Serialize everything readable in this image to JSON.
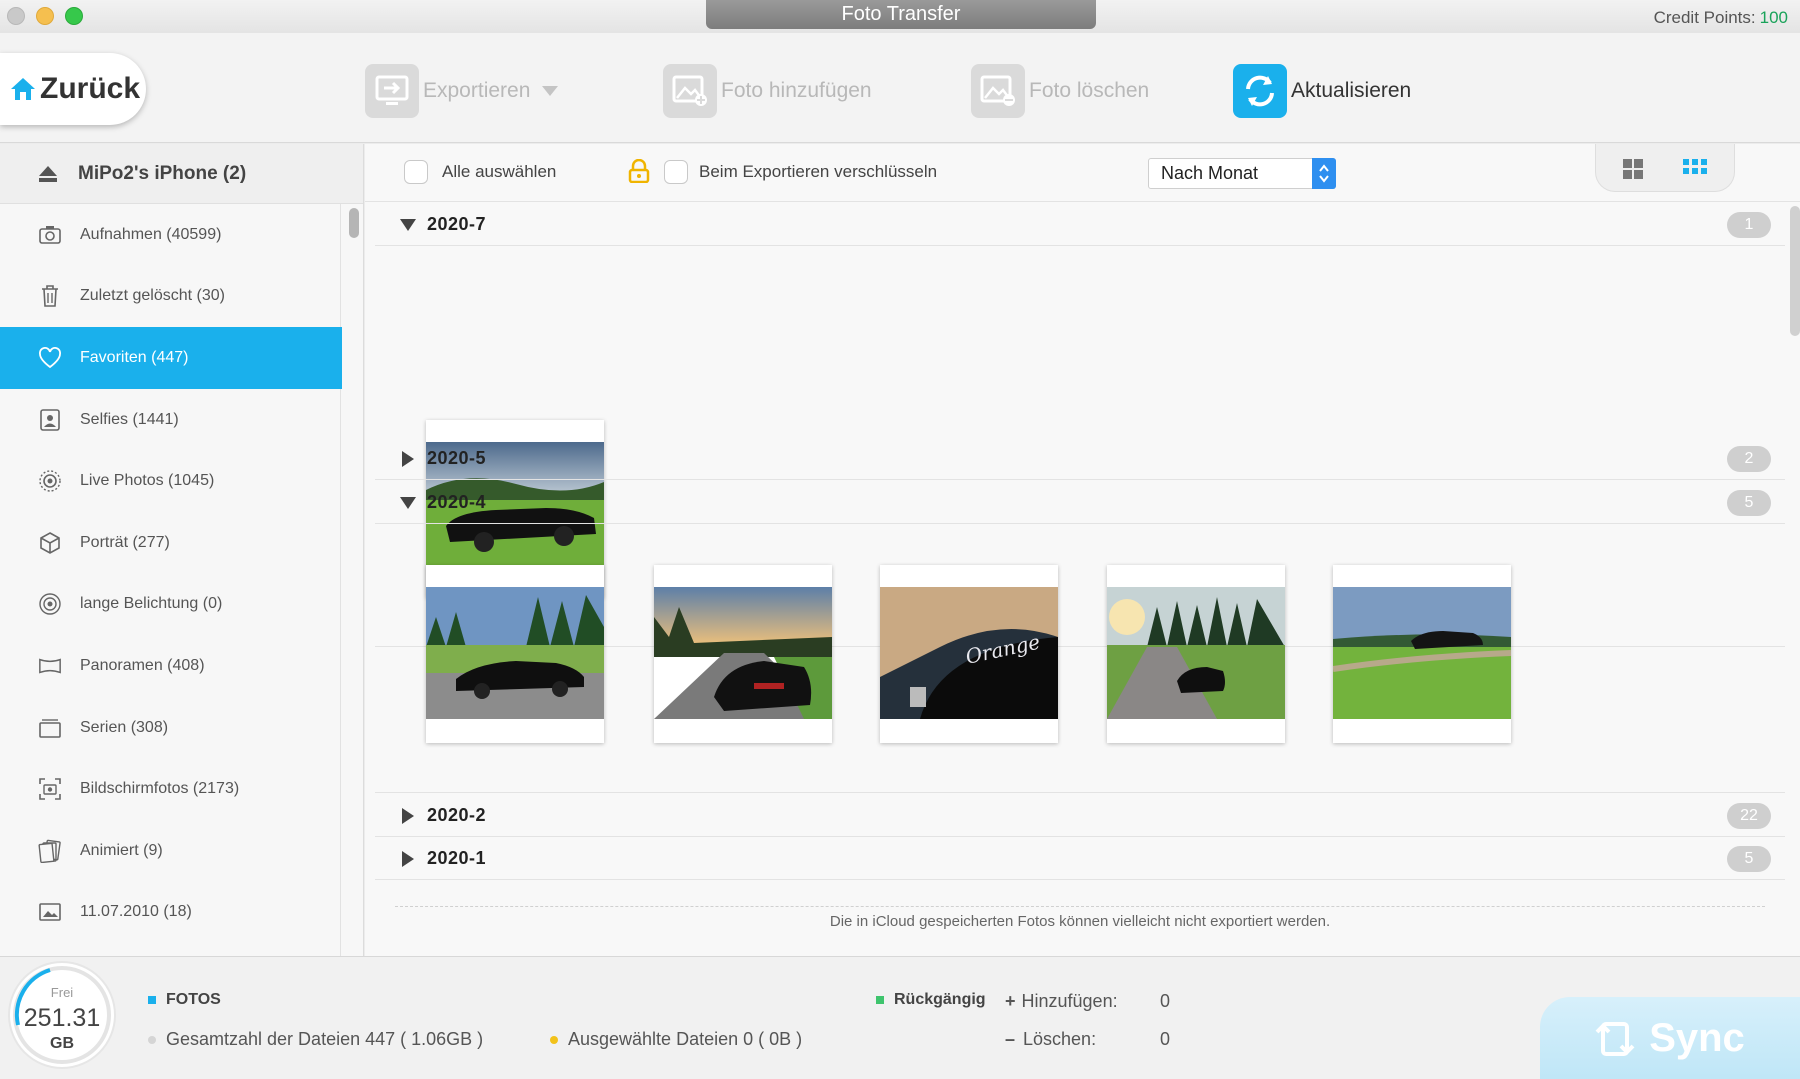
{
  "window": {
    "title": "Foto Transfer",
    "credit_label": "Credit Points:",
    "credit_value": "100"
  },
  "toolbar": {
    "back_label": "Zurück",
    "export_label": "Exportieren",
    "add_label": "Foto hinzufügen",
    "delete_label": "Foto löschen",
    "refresh_label": "Aktualisieren"
  },
  "sidebar": {
    "device": "MiPo2's iPhone (2)",
    "items": [
      {
        "label": "Aufnahmen (40599)",
        "icon": "camera-icon"
      },
      {
        "label": "Zuletzt gelöscht (30)",
        "icon": "trash-icon"
      },
      {
        "label": "Favoriten (447)",
        "icon": "heart-icon",
        "selected": true
      },
      {
        "label": "Selfies (1441)",
        "icon": "portrait-icon"
      },
      {
        "label": "Live Photos (1045)",
        "icon": "live-photo-icon"
      },
      {
        "label": "Porträt (277)",
        "icon": "cube-icon"
      },
      {
        "label": "lange Belichtung (0)",
        "icon": "long-exposure-icon"
      },
      {
        "label": "Panoramen (408)",
        "icon": "panorama-icon"
      },
      {
        "label": "Serien (308)",
        "icon": "burst-icon"
      },
      {
        "label": "Bildschirmfotos (2173)",
        "icon": "screenshot-icon"
      },
      {
        "label": "Animiert (9)",
        "icon": "animated-icon"
      },
      {
        "label": "11.07.2010 (18)",
        "icon": "album-icon"
      }
    ]
  },
  "filter": {
    "select_all": "Alle auswählen",
    "encrypt": "Beim Exportieren verschlüsseln",
    "sort": "Nach Monat"
  },
  "groups": [
    {
      "name": "2020-7",
      "count": "1",
      "expanded": true
    },
    {
      "name": "2020-5",
      "count": "2",
      "expanded": false
    },
    {
      "name": "2020-4",
      "count": "5",
      "expanded": true
    },
    {
      "name": "2020-2",
      "count": "22",
      "expanded": false
    },
    {
      "name": "2020-1",
      "count": "5",
      "expanded": false
    }
  ],
  "icloud_note": "Die in iCloud gespeicherten Fotos können vielleicht nicht exportiert werden.",
  "bottom": {
    "gauge_label": "Frei",
    "gauge_value": "251.31",
    "gauge_unit": "GB",
    "section": "FOTOS",
    "total": "Gesamtzahl der Dateien 447 ( 1.06GB )",
    "selected": "Ausgewählte Dateien 0 ( 0B )",
    "undo": "Rückgängig",
    "add_label": "Hinzufügen:",
    "add_value": "0",
    "del_label": "Löschen:",
    "del_value": "0",
    "sync": "Sync"
  },
  "colors": {
    "accent": "#1ab0ec",
    "credit": "#1aa35a"
  }
}
